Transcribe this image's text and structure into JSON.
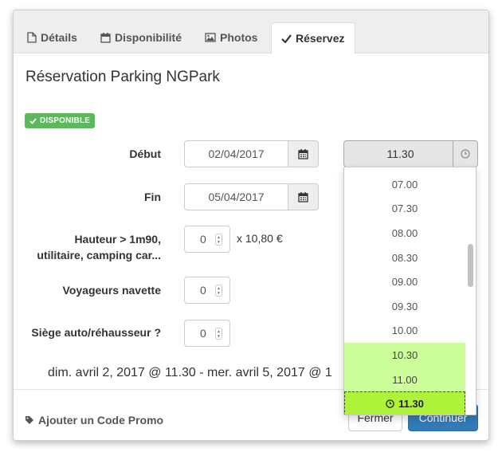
{
  "tabs": [
    {
      "label": "Détails",
      "icon": "file-icon"
    },
    {
      "label": "Disponibilité",
      "icon": "calendar-icon"
    },
    {
      "label": "Photos",
      "icon": "picture-icon"
    },
    {
      "label": "Réservez",
      "icon": "check-icon",
      "active": true
    }
  ],
  "title": "Réservation Parking NGPark",
  "badge": "DISPONIBLE",
  "form": {
    "start_label": "Début",
    "start_date": "02/04/2017",
    "start_time": "11.30",
    "end_label": "Fin",
    "end_date": "05/04/2017",
    "height_label_line1": "Hauteur > 1m90,",
    "height_label_line2": "utilitaire, camping car...",
    "height_value": "0",
    "height_price": "x 10,80 €",
    "shuttle_label": "Voyageurs navette",
    "shuttle_value": "0",
    "seat_label": "Siège auto/réhausseur ?",
    "seat_value": "0"
  },
  "summary": "dim. avril 2, 2017 @ 11.30 - mer. avril 5, 2017 @ 1",
  "footer": {
    "promo_label": "Ajouter un Code Promo",
    "close_label": "Fermer",
    "continue_label": "Continuer"
  },
  "time_options": [
    {
      "label": "07.00",
      "state": "normal"
    },
    {
      "label": "07.30",
      "state": "normal"
    },
    {
      "label": "08.00",
      "state": "normal"
    },
    {
      "label": "08.30",
      "state": "normal"
    },
    {
      "label": "09.00",
      "state": "normal"
    },
    {
      "label": "09.30",
      "state": "normal"
    },
    {
      "label": "10.00",
      "state": "normal"
    },
    {
      "label": "10.30",
      "state": "available"
    },
    {
      "label": "11.00",
      "state": "available"
    },
    {
      "label": "11.30",
      "state": "selected"
    }
  ],
  "colors": {
    "available": "#ccff99",
    "selected": "#aef23a",
    "badge": "#5cb85c",
    "primary": "#337ab7"
  }
}
